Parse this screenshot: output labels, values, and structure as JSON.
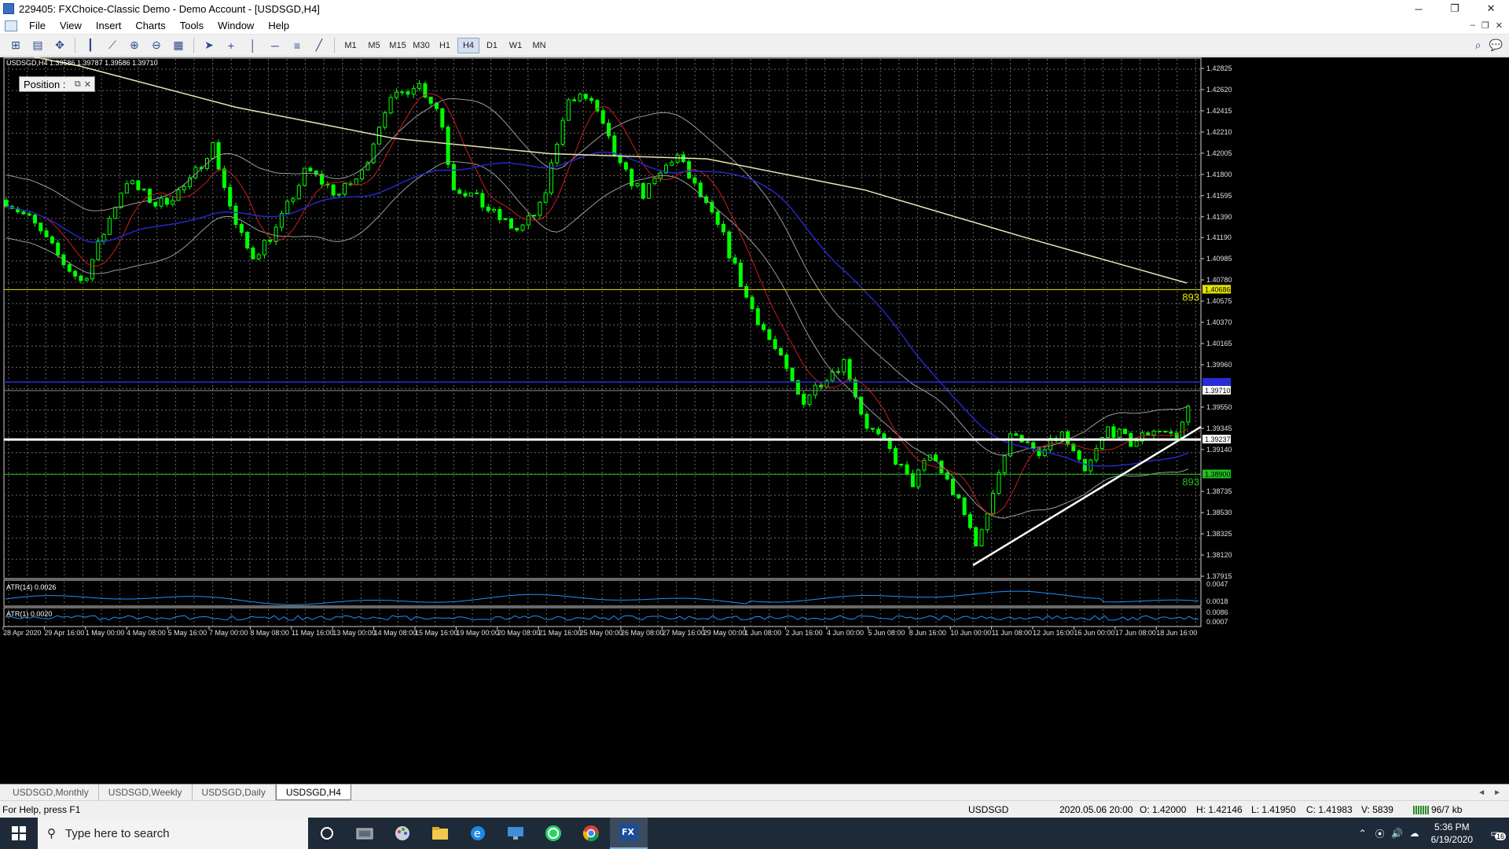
{
  "window": {
    "title": "229405: FXChoice-Classic Demo - Demo Account - [USDSGD,H4]",
    "minimize_glyph": "─",
    "restore_glyph": "❐",
    "close_glyph": "✕"
  },
  "menu": {
    "items": [
      "File",
      "View",
      "Insert",
      "Charts",
      "Tools",
      "Window",
      "Help"
    ],
    "mdi_controls": [
      "–",
      "❐",
      "✕"
    ]
  },
  "toolbar": {
    "timeframes": [
      "M1",
      "M5",
      "M15",
      "M30",
      "H1",
      "H4",
      "D1",
      "W1",
      "MN"
    ],
    "active_timeframe": "H4"
  },
  "chart": {
    "info": "USDSGD,H4  1.39586 1.39787 1.39586 1.39710",
    "position_panel_label": "Position :",
    "line_labels": {
      "upper_count": "893",
      "lower_count": "893"
    },
    "price_ticks": [
      "1.42825",
      "1.42620",
      "1.42415",
      "1.42210",
      "1.42005",
      "1.41800",
      "1.41595",
      "1.41390",
      "1.41190",
      "1.40985",
      "1.40780",
      "1.40575",
      "1.40370",
      "1.40165",
      "1.39960",
      "1.39550",
      "1.39345",
      "1.39140",
      "1.38735",
      "1.38530",
      "1.38325",
      "1.38120",
      "1.37915"
    ],
    "price_tags": {
      "yellow_line": "1.40686",
      "current_bid": "1.39710",
      "white_line": "1.39237",
      "green_line": "1.38900"
    },
    "time_labels": [
      "28 Apr 2020",
      "29 Apr 16:00",
      "1 May 00:00",
      "4 May 08:00",
      "5 May 16:00",
      "7 May 00:00",
      "8 May 08:00",
      "11 May 16:00",
      "13 May 00:00",
      "14 May 08:00",
      "15 May 16:00",
      "19 May 00:00",
      "20 May 08:00",
      "21 May 16:00",
      "25 May 00:00",
      "26 May 08:00",
      "27 May 16:00",
      "29 May 00:00",
      "1 Jun 08:00",
      "2 Jun 16:00",
      "4 Jun 00:00",
      "5 Jun 08:00",
      "8 Jun 16:00",
      "10 Jun 00:00",
      "11 Jun 08:00",
      "12 Jun 16:00",
      "16 Jun 00:00",
      "17 Jun 08:00",
      "18 Jun 16:00"
    ],
    "indicator1": {
      "label": "ATR(14) 0.0026",
      "ticks": [
        "0.0047",
        "0.0018"
      ]
    },
    "indicator2": {
      "label": "ATR(1) 0.0020",
      "ticks": [
        "0.0086",
        "0.0007"
      ]
    },
    "colors": {
      "candle": "#00ff00",
      "bollinger": "#9a9a9a",
      "ma_slow": "#e6e6b4",
      "ma_blue": "#2626c8",
      "ma_red": "#c81e1e",
      "atr": "#1e90ff"
    }
  },
  "tabs": {
    "items": [
      "USDSGD,Monthly",
      "USDSGD,Weekly",
      "USDSGD,Daily",
      "USDSGD,H4"
    ],
    "active": "USDSGD,H4",
    "scroll_left": "◄",
    "scroll_right": "►"
  },
  "status": {
    "help": "For Help, press F1",
    "symbol": "USDSGD",
    "datetime": "2020.05.06 20:00",
    "open": "O: 1.42000",
    "high": "H: 1.42146",
    "low": "L: 1.41950",
    "close": "C: 1.41983",
    "volume": "V: 5839",
    "traffic": "96/7 kb"
  },
  "taskbar": {
    "search_placeholder": "Type here to search",
    "time": "5:36 PM",
    "date": "6/19/2020",
    "notification_count": "16"
  }
}
